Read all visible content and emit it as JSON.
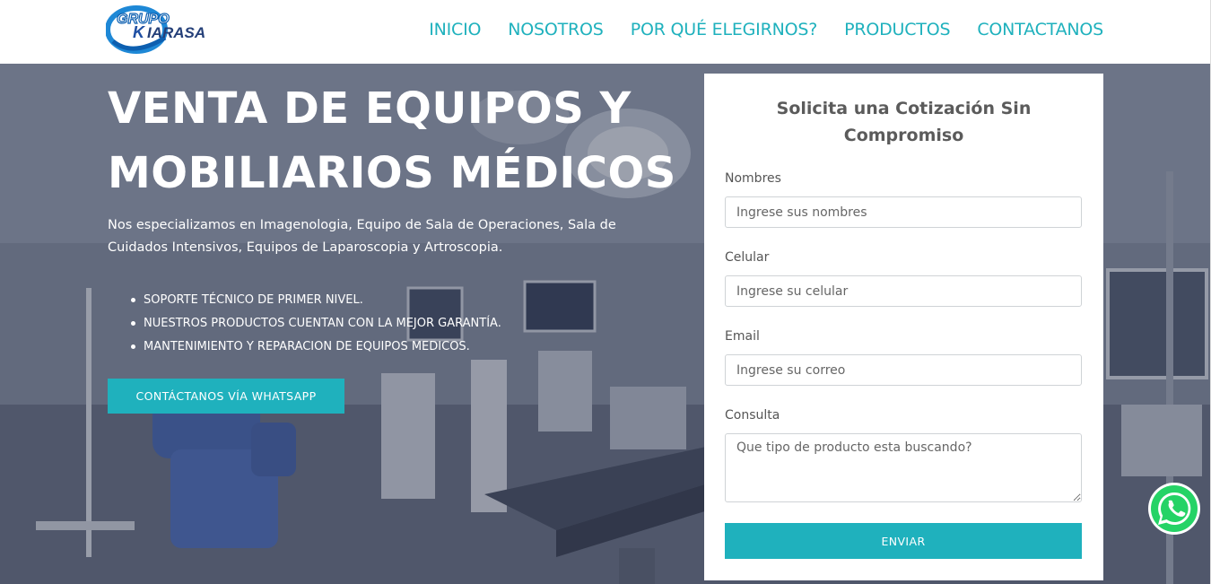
{
  "brand": {
    "logo_line1": "GRUPO",
    "logo_line2": "KIARASA",
    "accent": "#1fb1bd"
  },
  "nav": {
    "items": [
      {
        "label": "INICIO"
      },
      {
        "label": "NOSOTROS"
      },
      {
        "label": "POR QUÉ ELEGIRNOS?"
      },
      {
        "label": "PRODUCTOS"
      },
      {
        "label": "CONTACTANOS"
      }
    ]
  },
  "hero": {
    "title_line1": "VENTA DE EQUIPOS Y",
    "title_line2": "MOBILIARIOS MÉDICOS",
    "description": "Nos especializamos en Imagenologia, Equipo de Sala de Operaciones, Sala de Cuidados Intensivos, Equipos de Laparoscopia y Artroscopia.",
    "bullets": [
      "SOPORTE TÉCNICO DE PRIMER NIVEL.",
      "NUESTROS PRODUCTOS CUENTAN CON LA MEJOR GARANTÍA.",
      "MANTENIMIENTO Y REPARACION DE EQUIPOS MEDICOS."
    ],
    "cta_label": "CONTÁCTANOS VÍA WHATSAPP"
  },
  "form": {
    "title": "Solicita una Cotización Sin Compromiso",
    "nombres_label": "Nombres",
    "nombres_placeholder": "Ingrese sus nombres",
    "celular_label": "Celular",
    "celular_placeholder": "Ingrese su celular",
    "email_label": "Email",
    "email_placeholder": "Ingrese su correo",
    "consulta_label": "Consulta",
    "consulta_placeholder": "Que tipo de producto esta buscando?",
    "submit_label": "ENVIAR"
  },
  "icons": {
    "whatsapp": "whatsapp-icon"
  }
}
